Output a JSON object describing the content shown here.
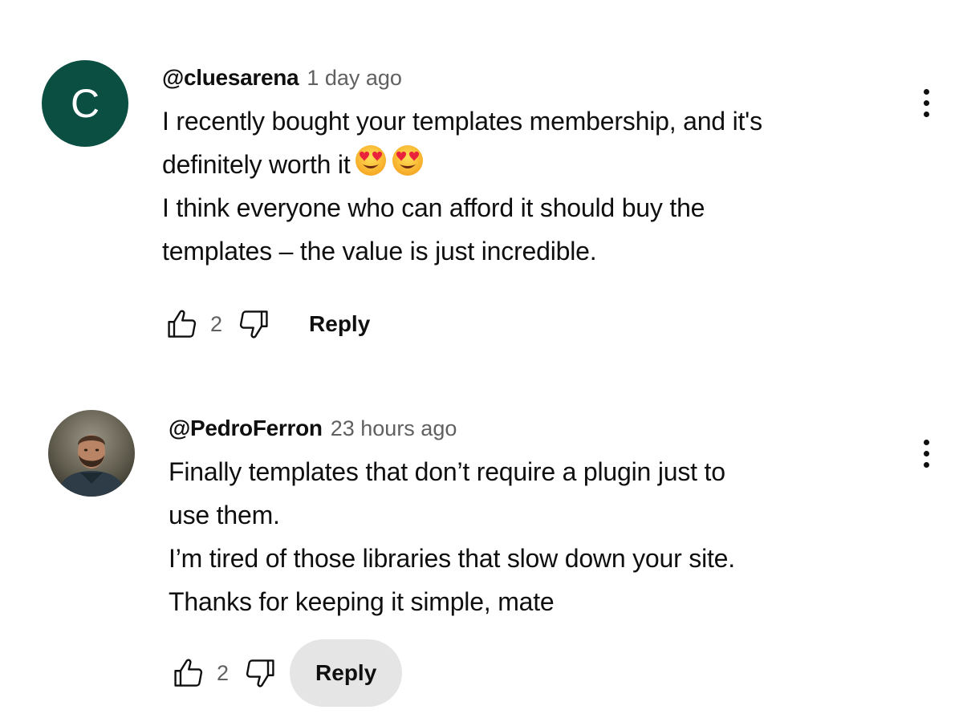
{
  "comments": [
    {
      "author": "@cluesarena",
      "timestamp": "1 day ago",
      "avatar": {
        "type": "letter",
        "letter": "C",
        "color": "#0b4f43"
      },
      "lines": [
        "I recently bought your templates membership, and it's",
        "definitely worth it",
        "I think everyone who can afford it should buy the",
        "templates – the value is just incredible."
      ],
      "emojis": [
        "heart-eyes-emoji",
        "heart-eyes-emoji"
      ],
      "like_count": "2",
      "reply_label": "Reply"
    },
    {
      "author": "@PedroFerron",
      "timestamp": "23 hours ago",
      "avatar": {
        "type": "photo",
        "description_icon": "user-photo-avatar"
      },
      "lines": [
        "Finally templates that don’t require a plugin just to",
        "use them.",
        "I’m tired of those libraries that slow down your site.",
        "Thanks for keeping it simple, mate"
      ],
      "like_count": "2",
      "reply_label": "Reply",
      "reply_hovered": true
    }
  ],
  "icons": {
    "like": "thumb-up-outline-icon",
    "dislike": "thumb-down-outline-icon",
    "menu": "more-vert-icon"
  },
  "colors": {
    "text": "#0f0f0f",
    "secondary": "#606060",
    "reply_hover_bg": "#e5e5e5"
  }
}
